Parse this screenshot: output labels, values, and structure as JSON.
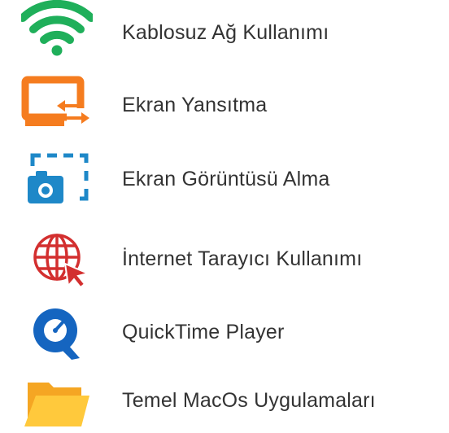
{
  "menu": {
    "items": [
      {
        "label": "Kablosuz Ağ Kullanımı",
        "icon": "wifi-icon",
        "color": "#1FAF5A"
      },
      {
        "label": "Ekran Yansıtma",
        "icon": "screen-mirroring-icon",
        "color": "#F57C1F"
      },
      {
        "label": "Ekran Görüntüsü Alma",
        "icon": "screenshot-camera-icon",
        "color": "#1E88C8"
      },
      {
        "label": "İnternet Tarayıcı Kullanımı",
        "icon": "web-browser-globe-icon",
        "color": "#D32F2F"
      },
      {
        "label": "QuickTime Player",
        "icon": "quicktime-icon",
        "color": "#1565C0"
      },
      {
        "label": "Temel MacOs Uygulamaları",
        "icon": "folder-icon",
        "color": "#F9A825"
      }
    ]
  }
}
